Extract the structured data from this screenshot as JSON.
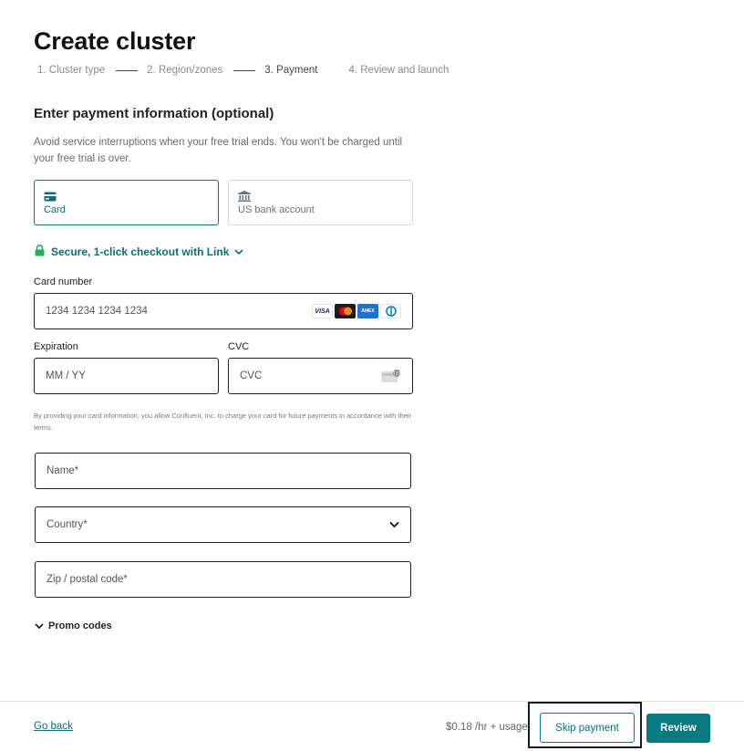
{
  "page": {
    "title": "Create cluster"
  },
  "steps": [
    {
      "label": "1. Cluster type",
      "state": "done"
    },
    {
      "label": "2. Region/zones",
      "state": "done"
    },
    {
      "label": "3. Payment",
      "state": "active"
    },
    {
      "label": "4. Review and launch",
      "state": "upcoming"
    }
  ],
  "payment": {
    "title": "Enter payment information (optional)",
    "description": "Avoid service interruptions when your free trial ends. You won't be charged until your free trial is over.",
    "methods": [
      {
        "label": "Card",
        "icon": "card-icon",
        "selected": true
      },
      {
        "label": "US bank account",
        "icon": "bank-icon",
        "selected": false
      }
    ],
    "link_checkout": "Secure, 1-click checkout with Link"
  },
  "card_form": {
    "card_number_label": "Card number",
    "card_number_placeholder": "1234 1234 1234 1234",
    "card_brands": [
      "VISA",
      "mastercard",
      "AMEX",
      "diners"
    ],
    "expiration_label": "Expiration",
    "expiration_placeholder": "MM / YY",
    "cvc_label": "CVC",
    "cvc_placeholder": "CVC",
    "legal_text": "By providing your card information, you allow Confluent, Inc. to charge your card for future payments in accordance with their terms.",
    "name_placeholder": "Name*",
    "country_placeholder": "Country*",
    "zip_placeholder": "Zip / postal code*",
    "promo_label": "Promo codes"
  },
  "footer": {
    "go_back": "Go back",
    "price": "$0.18 /hr + usage",
    "skip_label": "Skip payment",
    "review_label": "Review"
  },
  "colors": {
    "accent": "#0a7a82",
    "link_text": "#0a6f77",
    "lock": "#1fb35a"
  }
}
